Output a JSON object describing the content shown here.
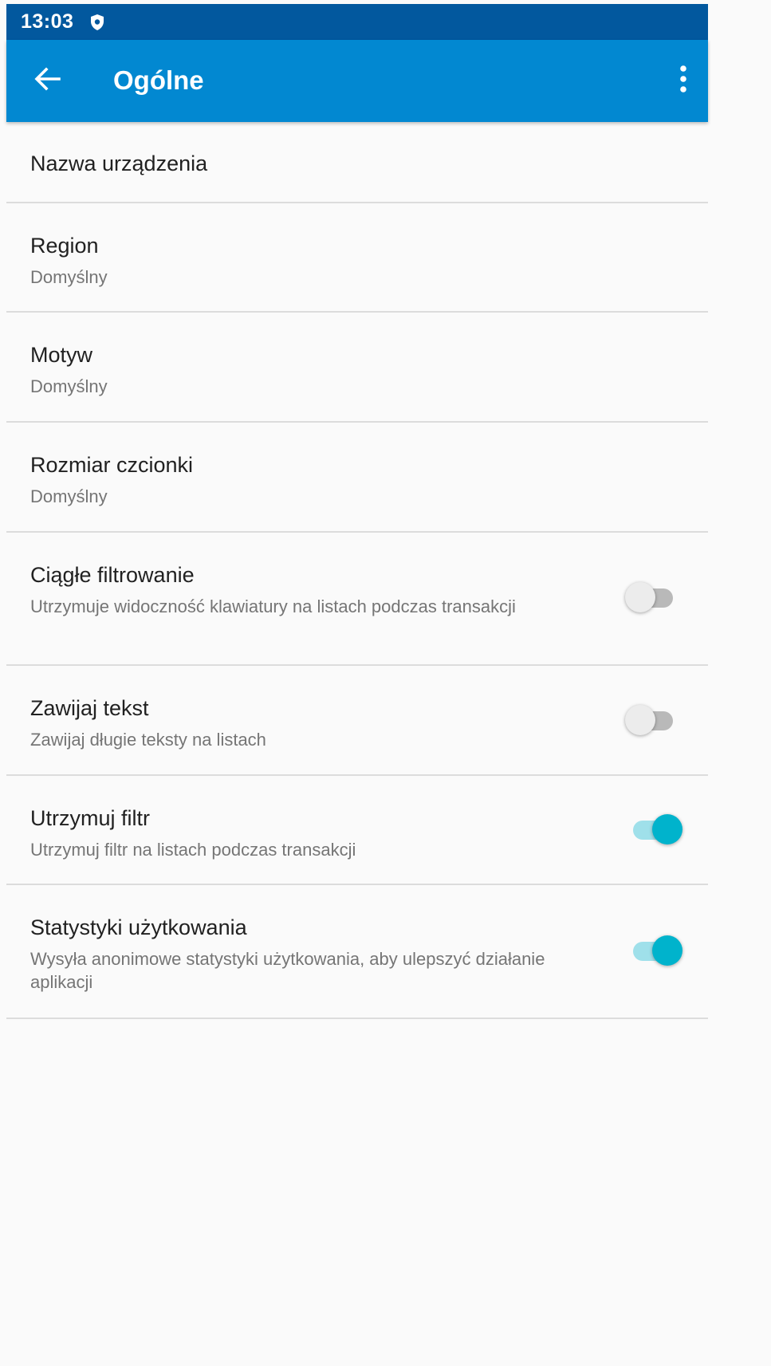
{
  "status_bar": {
    "time": "13:03",
    "icon": "shield-icon"
  },
  "app_bar": {
    "title": "Ogólne",
    "back_icon": "arrow-back-icon",
    "menu_icon": "more-vert-icon"
  },
  "colors": {
    "status_bar": "#02589e",
    "app_bar": "#0288d1",
    "switch_on": "#00b3cc",
    "switch_on_track": "#9fe0ea",
    "switch_off_track": "#b9b9b9"
  },
  "settings": [
    {
      "title": "Nazwa urządzenia"
    },
    {
      "title": "Region",
      "subtitle": "Domyślny"
    },
    {
      "title": "Motyw",
      "subtitle": "Domyślny"
    },
    {
      "title": "Rozmiar czcionki",
      "subtitle": "Domyślny"
    },
    {
      "title": "Ciągłe filtrowanie",
      "subtitle": "Utrzymuje widoczność klawiatury na listach podczas transakcji",
      "toggle": false
    },
    {
      "title": "Zawijaj tekst",
      "subtitle": "Zawijaj długie teksty na listach",
      "toggle": false
    },
    {
      "title": "Utrzymuj filtr",
      "subtitle": "Utrzymuj filtr na listach podczas transakcji",
      "toggle": true
    },
    {
      "title": "Statystyki użytkowania",
      "subtitle": "Wysyła anonimowe statystyki użytkowania, aby ulepszyć działanie aplikacji",
      "toggle": true
    }
  ]
}
